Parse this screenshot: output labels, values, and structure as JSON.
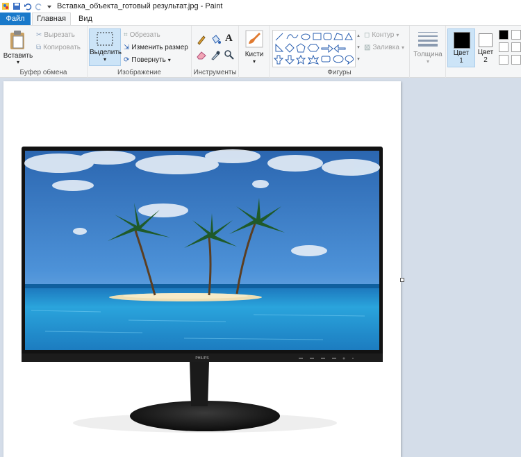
{
  "window": {
    "title": "Вставка_объекта_готовый результат.jpg - Paint"
  },
  "tabs": {
    "file": "Файл",
    "home": "Главная",
    "view": "Вид"
  },
  "clipboard": {
    "paste": "Вставить",
    "cut": "Вырезать",
    "copy": "Копировать",
    "group_label": "Буфер обмена"
  },
  "image": {
    "select": "Выделить",
    "crop": "Обрезать",
    "resize": "Изменить размер",
    "rotate": "Повернуть",
    "group_label": "Изображение"
  },
  "tools": {
    "group_label": "Инструменты"
  },
  "brushes": {
    "label": "Кисти"
  },
  "shapes": {
    "group_label": "Фигуры",
    "outline": "Контур",
    "fill": "Заливка"
  },
  "size": {
    "label": "Толщина"
  },
  "colors": {
    "color1_label": "Цвет",
    "color1_num": "1",
    "color2_label": "Цвет",
    "color2_num": "2",
    "color1": "#000000",
    "color2": "#ffffff"
  },
  "monitor": {
    "brand": "PHILIPS"
  }
}
